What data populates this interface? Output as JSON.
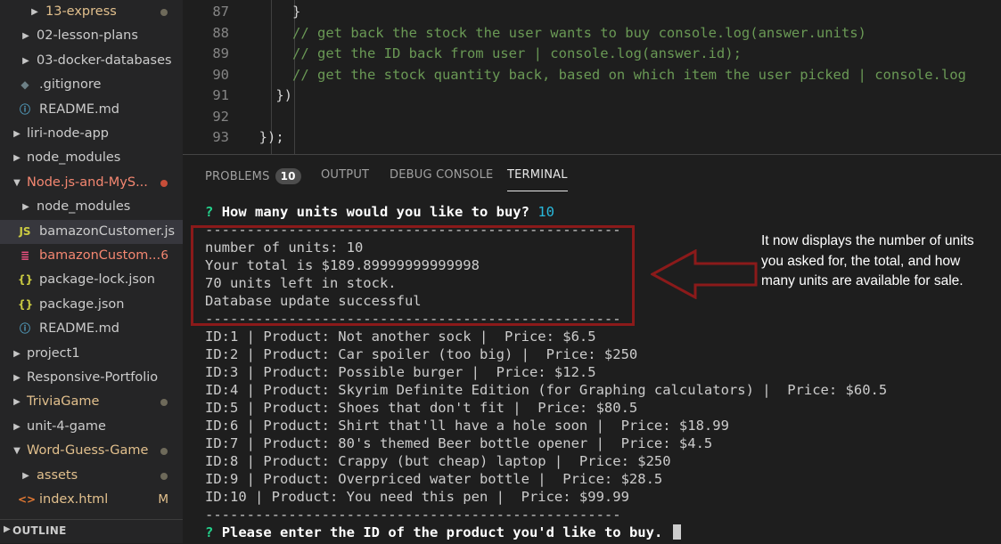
{
  "sidebar": {
    "items": [
      {
        "label": "13-express",
        "color": "#e2c08d",
        "chevron": "▶",
        "dot": true
      },
      {
        "label": "02-lesson-plans",
        "color": "#cccccc",
        "chevron": "▶"
      },
      {
        "label": "03-docker-databases",
        "color": "#cccccc",
        "chevron": "▶"
      },
      {
        "label": ".gitignore",
        "color": "#cccccc",
        "icon": "◆",
        "icon_color": "#6d8086"
      },
      {
        "label": "README.md",
        "color": "#cccccc",
        "icon": "ⓘ",
        "icon_color": "#519aba"
      },
      {
        "label": "liri-node-app",
        "color": "#cccccc",
        "chevron": "▶"
      },
      {
        "label": "node_modules",
        "color": "#cccccc",
        "chevron": "▶"
      },
      {
        "label": "Node.js-and-MyS...",
        "color": "#f48771",
        "chevron": "▼",
        "dot": true,
        "dot_color": "#c74e39"
      },
      {
        "label": "node_modules",
        "color": "#cccccc",
        "chevron": "▶"
      },
      {
        "label": "bamazonCustomer.js",
        "color": "#cccccc",
        "icon": "JS",
        "icon_color": "#cbcb41",
        "active": true
      },
      {
        "label": "bamazonCustom...",
        "color": "#f48771",
        "icon": "≣",
        "icon_color": "#f55385",
        "badge": "6"
      },
      {
        "label": "package-lock.json",
        "color": "#cccccc",
        "icon": "{}",
        "icon_color": "#cbcb41"
      },
      {
        "label": "package.json",
        "color": "#cccccc",
        "icon": "{}",
        "icon_color": "#cbcb41"
      },
      {
        "label": "README.md",
        "color": "#cccccc",
        "icon": "ⓘ",
        "icon_color": "#519aba"
      },
      {
        "label": "project1",
        "color": "#cccccc",
        "chevron": "▶"
      },
      {
        "label": "Responsive-Portfolio",
        "color": "#cccccc",
        "chevron": "▶"
      },
      {
        "label": "TriviaGame",
        "color": "#e2c08d",
        "chevron": "▶",
        "dot": true
      },
      {
        "label": "unit-4-game",
        "color": "#cccccc",
        "chevron": "▶"
      },
      {
        "label": "Word-Guess-Game",
        "color": "#e2c08d",
        "chevron": "▼",
        "dot": true
      },
      {
        "label": "assets",
        "color": "#e2c08d",
        "chevron": "▶",
        "dot": true
      },
      {
        "label": "index.html",
        "color": "#e2c08d",
        "icon": "<>",
        "icon_color": "#e37933",
        "badge": "M"
      }
    ],
    "outline_label": "OUTLINE"
  },
  "editor": {
    "lines": [
      {
        "num": "87",
        "text": "      }",
        "color": "#d4d4d4"
      },
      {
        "num": "88",
        "text": "      // get back the stock the user wants to buy console.log(answer.units)",
        "color": "#6a9955"
      },
      {
        "num": "89",
        "text": "      // get the ID back from user | console.log(answer.id);",
        "color": "#6a9955"
      },
      {
        "num": "90",
        "text": "      // get the stock quantity back, based on which item the user picked | console.log",
        "color": "#6a9955"
      },
      {
        "num": "91",
        "text": "    })",
        "color": "#d4d4d4"
      },
      {
        "num": "92",
        "text": "",
        "color": "#d4d4d4"
      },
      {
        "num": "93",
        "text": "  });",
        "color": "#d4d4d4"
      }
    ]
  },
  "panel": {
    "tabs": {
      "problems": "PROBLEMS",
      "problems_count": "10",
      "output": "OUTPUT",
      "debug": "DEBUG CONSOLE",
      "terminal": "TERMINAL"
    },
    "terminal": {
      "prompt_mark": "?",
      "question1": "How many units would you like to buy?",
      "answer1": "10",
      "separator": "--------------------------------------------------",
      "result_lines": [
        "number of units: 10",
        "Your total is $189.89999999999998",
        "70 units left in stock.",
        "Database update successful"
      ],
      "products": [
        "ID:1 | Product: Not another sock |  Price: $6.5",
        "ID:2 | Product: Car spoiler (too big) |  Price: $250",
        "ID:3 | Product: Possible burger |  Price: $12.5",
        "ID:4 | Product: Skyrim Definite Edition (for Graphing calculators) |  Price: $60.5",
        "ID:5 | Product: Shoes that don't fit |  Price: $80.5",
        "ID:6 | Product: Shirt that'll have a hole soon |  Price: $18.99",
        "ID:7 | Product: 80's themed Beer bottle opener |  Price: $4.5",
        "ID:8 | Product: Crappy (but cheap) laptop |  Price: $250",
        "ID:9 | Product: Overpriced water bottle |  Price: $28.5",
        "ID:10 | Product: You need this pen |  Price: $99.99"
      ],
      "question2": "Please enter the ID of the product you'd like to buy."
    }
  },
  "annotation": {
    "note": "It now displays the number of units you asked for, the total, and how many units are available for sale.",
    "color": "#8b1a1a"
  }
}
